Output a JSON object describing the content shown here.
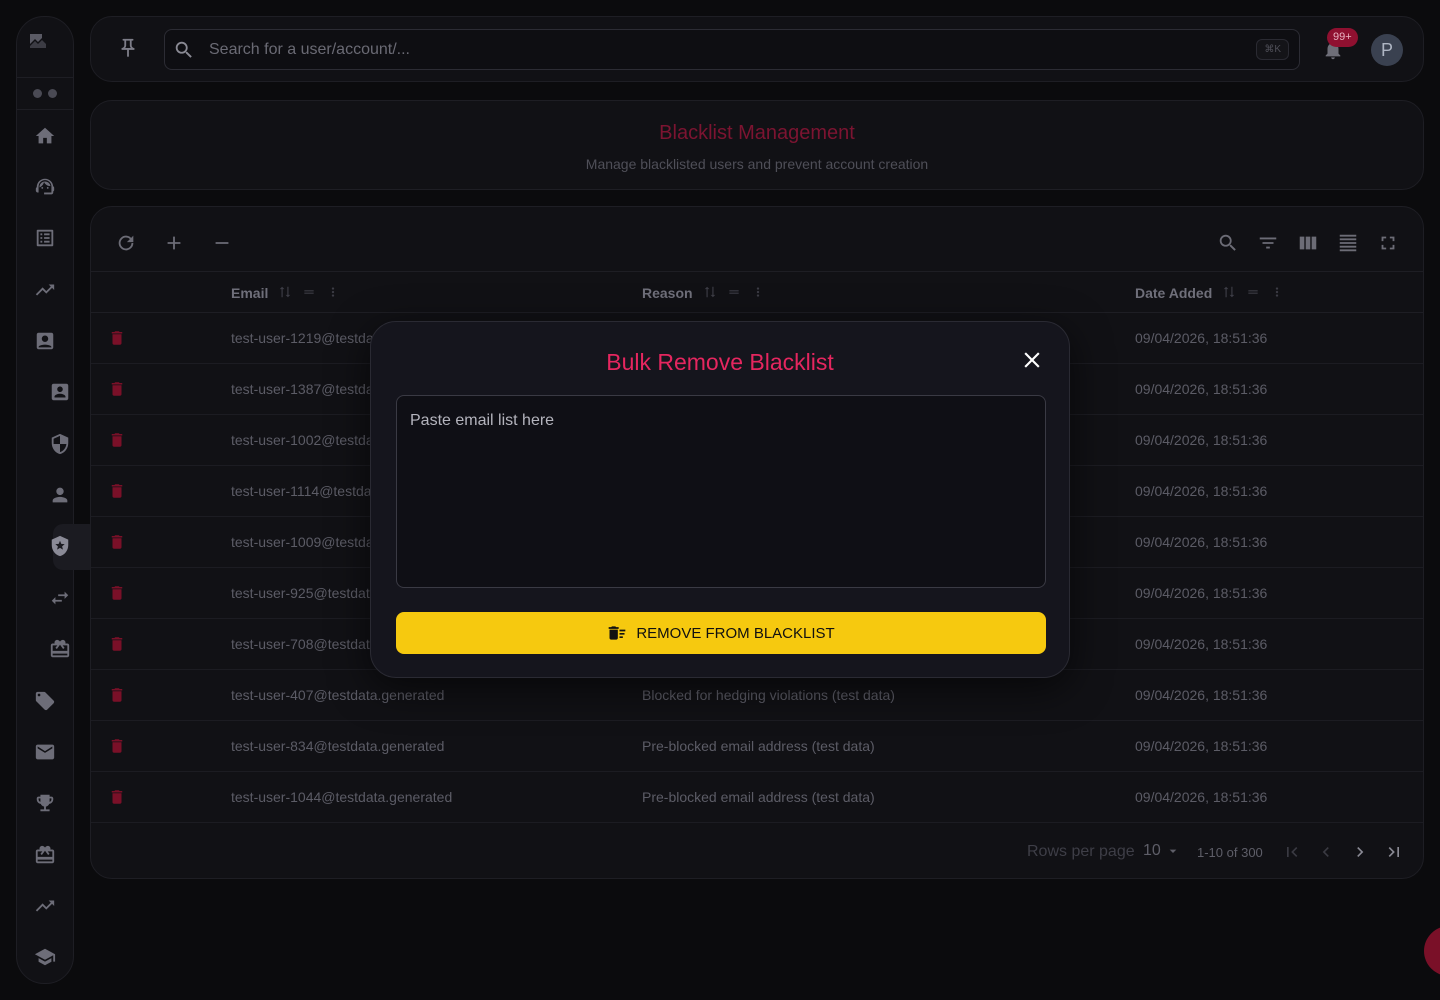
{
  "colors": {
    "accent": "#e5265f",
    "primary_button": "#f6c90f",
    "delete_icon": "#7a1028",
    "badge": "#8f1030"
  },
  "sidebar": {
    "items": [
      {
        "name": "home-icon"
      },
      {
        "name": "support-agent-icon"
      },
      {
        "name": "list-alt-icon"
      },
      {
        "name": "trending-up-icon"
      },
      {
        "name": "contact-card-icon"
      },
      {
        "name": "account-box-icon"
      },
      {
        "name": "shield-icon"
      },
      {
        "name": "person-icon"
      },
      {
        "name": "shield-star-icon",
        "active": true
      },
      {
        "name": "swap-icon"
      },
      {
        "name": "ticket-icon"
      },
      {
        "name": "tag-icon"
      },
      {
        "name": "mail-icon"
      },
      {
        "name": "trophy-icon"
      },
      {
        "name": "gift-icon"
      },
      {
        "name": "trending-up-icon"
      },
      {
        "name": "school-icon"
      }
    ]
  },
  "topbar": {
    "search_placeholder": "Search for a user/account/...",
    "shortcut": "⌘K",
    "notification_badge": "99+",
    "avatar_initial": "P"
  },
  "header": {
    "title": "Blacklist Management",
    "subtitle": "Manage blacklisted users and prevent account creation"
  },
  "table": {
    "columns": [
      {
        "label": "Email"
      },
      {
        "label": "Reason"
      },
      {
        "label": "Date Added"
      }
    ],
    "rows": [
      {
        "email": "test-user-1219@testda",
        "reason": "",
        "date": "09/04/2026, 18:51:36"
      },
      {
        "email": "test-user-1387@testda",
        "reason": "",
        "date": "09/04/2026, 18:51:36"
      },
      {
        "email": "test-user-1002@testda",
        "reason": "",
        "date": "09/04/2026, 18:51:36"
      },
      {
        "email": "test-user-1114@testda",
        "reason": "",
        "date": "09/04/2026, 18:51:36"
      },
      {
        "email": "test-user-1009@testda",
        "reason": "",
        "date": "09/04/2026, 18:51:36"
      },
      {
        "email": "test-user-925@testdat",
        "reason": "",
        "date": "09/04/2026, 18:51:36"
      },
      {
        "email": "test-user-708@testdat",
        "reason": "",
        "date": "09/04/2026, 18:51:36"
      },
      {
        "email": "test-user-407@testdata.generated",
        "reason": "Blocked for hedging violations (test data)",
        "date": "09/04/2026, 18:51:36"
      },
      {
        "email": "test-user-834@testdata.generated",
        "reason": "Pre-blocked email address (test data)",
        "date": "09/04/2026, 18:51:36"
      },
      {
        "email": "test-user-1044@testdata.generated",
        "reason": "Pre-blocked email address (test data)",
        "date": "09/04/2026, 18:51:36"
      }
    ]
  },
  "pagination": {
    "rows_per_page_label": "Rows per page",
    "rows_per_page_value": "10",
    "range": "1-10 of 300"
  },
  "modal": {
    "title": "Bulk Remove Blacklist",
    "textarea_placeholder": "Paste email list here",
    "submit_label": "REMOVE FROM BLACKLIST"
  }
}
